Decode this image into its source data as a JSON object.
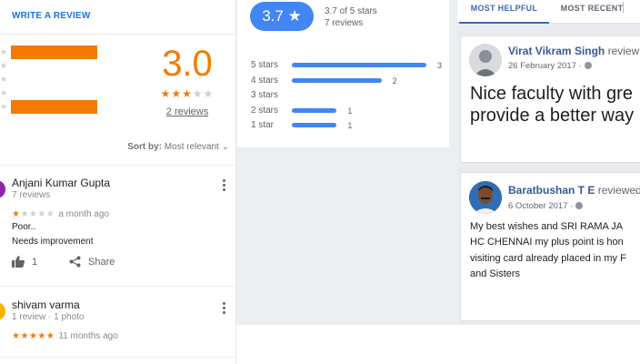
{
  "left_panel": {
    "write_review": "WRITE A REVIEW",
    "big_score": "3.0",
    "reviews_link": "2 reviews",
    "score_stars": {
      "rating": 3,
      "max": 5
    },
    "sort_prefix": "Sort by:",
    "sort_value": "Most relevant",
    "bar_fill_fractions": [
      1,
      0,
      0,
      0,
      1
    ],
    "accent_color": "#f47b00",
    "reviews": [
      {
        "name": "Anjani Kumar Gupta",
        "meta": "7 reviews",
        "rating": 1,
        "time": "a month ago",
        "text": [
          "Poor..",
          "Needs improvement"
        ],
        "like_count": "1",
        "share_label": "Share",
        "avatar_color": "#8e24aa"
      },
      {
        "name": "shivam varma",
        "meta": "1 review · 1 photo",
        "rating": 5,
        "time": "11 months ago",
        "avatar_color": "#f4b400"
      }
    ]
  },
  "middle_panel": {
    "pill_score": "3.7 ★",
    "summary_line1": "3.7 of 5 stars",
    "summary_line2": "7 reviews",
    "bar_color": "#4285f4",
    "distribution": [
      {
        "label": "5 stars",
        "count": 3
      },
      {
        "label": "4 stars",
        "count": 2
      },
      {
        "label": "3 stars",
        "count": 0
      },
      {
        "label": "2 stars",
        "count": 1
      },
      {
        "label": "1 star",
        "count": 1
      }
    ]
  },
  "right_panel": {
    "tabs": [
      "MOST HELPFUL",
      "MOST RECENT"
    ],
    "brand_color": "#4267b2",
    "posts": [
      {
        "name": "Virat Vikram Singh",
        "action": " review",
        "date": "26 February 2017 ·",
        "big_text": [
          "Nice faculty with gre",
          "provide a better way"
        ]
      },
      {
        "name": "Baratbushan T E",
        "action": " reviewed",
        "date": "6 October 2017 ·",
        "body": [
          "My best wishes and SRI RAMA JA",
          "HC CHENNAI my plus point is hon",
          "visiting card already placed in my F",
          "and Sisters"
        ]
      }
    ]
  }
}
